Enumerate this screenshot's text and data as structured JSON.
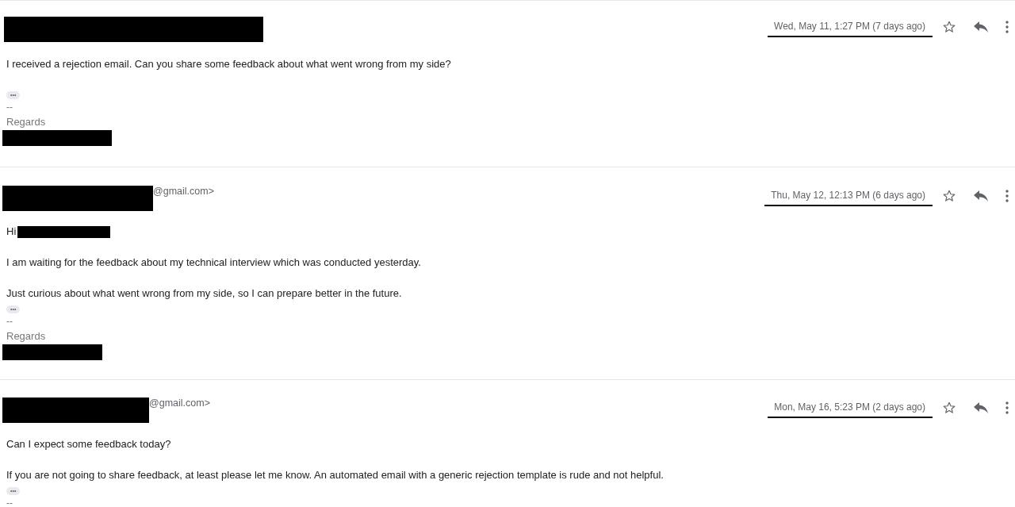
{
  "messages": [
    {
      "date": "Wed, May 11, 1:27 PM (7 days ago)",
      "starred": false,
      "body": [
        {
          "kind": "text",
          "text": "I received a rejection email. Can you share some feedback about what went wrong from my side?"
        },
        {
          "kind": "blank"
        },
        {
          "kind": "dots",
          "text": "•••"
        },
        {
          "kind": "dash",
          "text": "--"
        },
        {
          "kind": "signature",
          "text": "Regards"
        },
        {
          "kind": "redaction"
        }
      ]
    },
    {
      "sender_suffix": "@gmail.com>",
      "date": "Thu, May 12, 12:13 PM (6 days ago)",
      "starred": false,
      "body": [
        {
          "kind": "greeting",
          "text": "Hi"
        },
        {
          "kind": "blank"
        },
        {
          "kind": "text",
          "text": "I am waiting for the feedback about my technical interview which was conducted yesterday."
        },
        {
          "kind": "blank"
        },
        {
          "kind": "text",
          "text": "Just curious about what went wrong from my side, so I can prepare better in the future."
        },
        {
          "kind": "dots",
          "text": "•••"
        },
        {
          "kind": "dash",
          "text": "--"
        },
        {
          "kind": "signature",
          "text": "Regards"
        },
        {
          "kind": "redaction"
        }
      ]
    },
    {
      "sender_suffix": "@gmail.com>",
      "date": "Mon, May 16, 5:23 PM (2 days ago)",
      "starred": false,
      "body": [
        {
          "kind": "text",
          "text": "Can I expect some feedback today?"
        },
        {
          "kind": "blank"
        },
        {
          "kind": "text",
          "text": "If you are not going to share feedback, at least please let me know. An automated email with a generic rejection template is rude and not helpful."
        },
        {
          "kind": "dots",
          "text": "•••"
        },
        {
          "kind": "dash",
          "text": "--"
        }
      ]
    }
  ]
}
